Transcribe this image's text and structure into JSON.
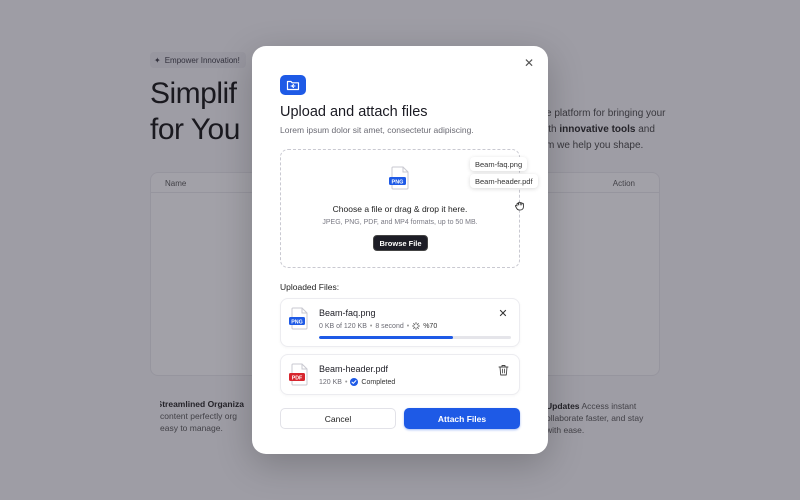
{
  "background": {
    "badge": "Empower Innovation!",
    "hero_line1": "Simplif",
    "hero_line2": "for You",
    "right_line1": "e platform for bringing your",
    "right_line2_pre": "ith ",
    "right_line2_bold": "innovative tools",
    "right_line2_post": " and",
    "right_line3": "m we help you shape.",
    "table_col_name": "Name",
    "table_col_action": "Action",
    "feature_left_title": "Streamlined Organiza",
    "feature_left_line2": "content perfectly org",
    "feature_left_line3": "easy to manage.",
    "feature_right_bold": "Updates",
    "feature_right_line1_rest": " Access instant",
    "feature_right_line2": "ollaborate faster, and stay",
    "feature_right_line3": "with ease."
  },
  "modal": {
    "title": "Upload and attach files",
    "subtitle": "Lorem ipsum dolor sit amet, consectetur adipiscing.",
    "dropzone": {
      "icon_label": "PNG",
      "title": "Choose a file or drag & drop it here.",
      "formats": "JPEG, PNG, PDF, and MP4 formats, up to 50 MB.",
      "browse_label": "Browse File"
    },
    "drag_chips": [
      "Beam-faq.png",
      "Beam-header.pdf"
    ],
    "uploaded_label": "Uploaded Files:",
    "files": [
      {
        "name": "Beam-faq.png",
        "type": "PNG",
        "size_info": "0 KB of 120 KB",
        "time": "8 second",
        "percent_label": "%70",
        "progress": 0.7
      },
      {
        "name": "Beam-header.pdf",
        "type": "PDF",
        "size_info": "120 KB",
        "status": "Completed"
      }
    ],
    "cancel_label": "Cancel",
    "attach_label": "Attach Files"
  },
  "colors": {
    "accent": "#1e5ae6",
    "pdf_red": "#d7262e",
    "png_blue": "#1e5ae6"
  }
}
